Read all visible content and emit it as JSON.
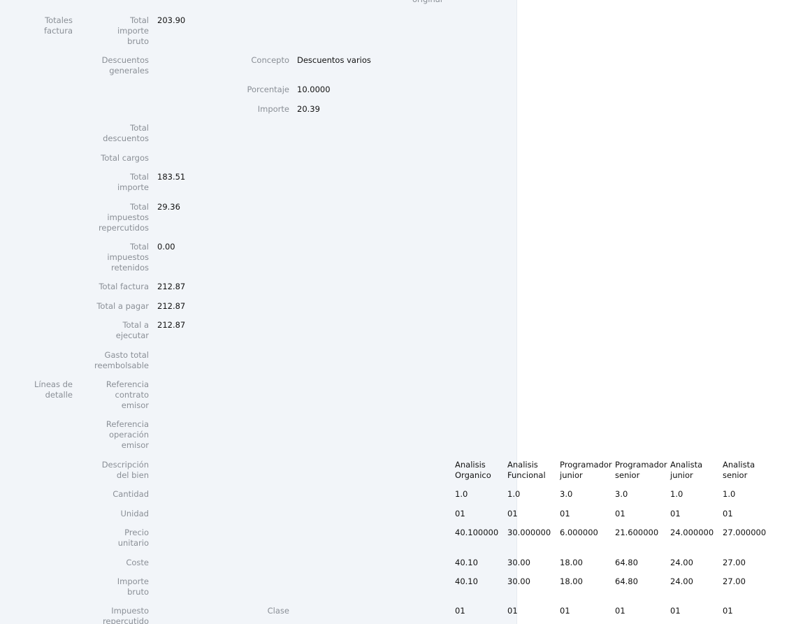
{
  "header_cut": "original",
  "totals": {
    "section_label": [
      "Totales",
      "factura"
    ],
    "total_importe_bruto": {
      "label": [
        "Total",
        "importe",
        "bruto"
      ],
      "value": "203.90"
    },
    "descuentos_generales": {
      "label": [
        "Descuentos",
        "generales"
      ],
      "concepto": {
        "label": "Concepto",
        "value": "Descuentos varios"
      },
      "porcentaje": {
        "label": "Porcentaje",
        "value": "10.0000"
      },
      "importe": {
        "label": "Importe",
        "value": "20.39"
      }
    },
    "total_descuentos": {
      "label": [
        "Total",
        "descuentos"
      ],
      "value": ""
    },
    "total_cargos": {
      "label": [
        "Total cargos"
      ],
      "value": ""
    },
    "total_importe": {
      "label": [
        "Total",
        "importe"
      ],
      "value": "183.51"
    },
    "total_impuestos_repercutidos": {
      "label": [
        "Total",
        "impuestos",
        "repercutidos"
      ],
      "value": "29.36"
    },
    "total_impuestos_retenidos": {
      "label": [
        "Total",
        "impuestos",
        "retenidos"
      ],
      "value": "0.00"
    },
    "total_factura": {
      "label": [
        "Total factura"
      ],
      "value": "212.87"
    },
    "total_a_pagar": {
      "label": [
        "Total a pagar"
      ],
      "value": "212.87"
    },
    "total_a_ejecutar": {
      "label": [
        "Total a",
        "ejecutar"
      ],
      "value": "212.87"
    },
    "gasto_total_reembolsable": {
      "label": [
        "Gasto total",
        "reembolsable"
      ],
      "value": ""
    }
  },
  "lines": {
    "section_label": [
      "Líneas de",
      "detalle"
    ],
    "referencia_contrato_emisor": {
      "label": [
        "Referencia",
        "contrato",
        "emisor"
      ]
    },
    "referencia_operacion_emisor": {
      "label": [
        "Referencia",
        "operación",
        "emisor"
      ]
    },
    "descripcion_del_bien": {
      "label": [
        "Descripción",
        "del bien"
      ],
      "values": [
        [
          "Analisis",
          "Organico"
        ],
        [
          "Analisis",
          "Funcional"
        ],
        [
          "Programador",
          "junior"
        ],
        [
          "Programador",
          "senior"
        ],
        [
          "Analista",
          "junior"
        ],
        [
          "Analista",
          "senior"
        ]
      ]
    },
    "cantidad": {
      "label": [
        "Cantidad"
      ],
      "values": [
        "1.0",
        "1.0",
        "3.0",
        "3.0",
        "1.0",
        "1.0"
      ]
    },
    "unidad": {
      "label": [
        "Unidad"
      ],
      "values": [
        "01",
        "01",
        "01",
        "01",
        "01",
        "01"
      ]
    },
    "precio_unitario": {
      "label": [
        "Precio",
        "unitario"
      ],
      "values": [
        "40.100000",
        "30.000000",
        "6.000000",
        "21.600000",
        "24.000000",
        "27.000000"
      ]
    },
    "coste": {
      "label": [
        "Coste"
      ],
      "values": [
        "40.10",
        "30.00",
        "18.00",
        "64.80",
        "24.00",
        "27.00"
      ]
    },
    "importe_bruto": {
      "label": [
        "Importe",
        "bruto"
      ],
      "values": [
        "40.10",
        "30.00",
        "18.00",
        "64.80",
        "24.00",
        "27.00"
      ]
    },
    "impuesto_repercutido": {
      "label": [
        "Impuesto",
        "repercutido"
      ],
      "clase_label": "Clase",
      "values": [
        "01",
        "01",
        "01",
        "01",
        "01",
        "01"
      ]
    }
  }
}
